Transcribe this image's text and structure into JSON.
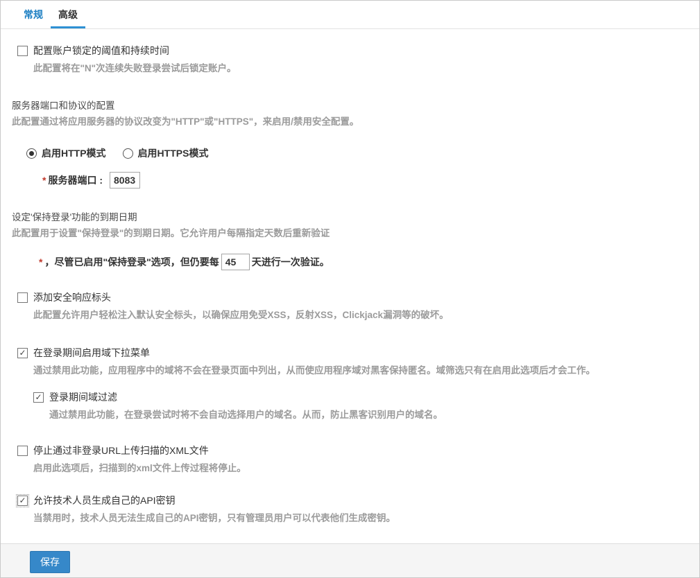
{
  "tabs": [
    {
      "label": "常规",
      "active": false
    },
    {
      "label": "高级",
      "active": true
    }
  ],
  "colors": {
    "accent_blue": "#1b7ec2",
    "tab_underline": "#2e91d4",
    "save_button": "#3688c9",
    "required_red": "#c0392c",
    "description_gray": "#9b9b9b"
  },
  "account_lockout": {
    "label": "配置账户锁定的阈值和持续时间",
    "checked": false,
    "description": "此配置将在\"N\"次连续失败登录尝试后锁定账户。"
  },
  "server": {
    "title": "服务器端口和协议的配置",
    "description": "此配置通过将应用服务器的协议改变为\"HTTP\"或\"HTTPS\"，来启用/禁用安全配置。",
    "http_label": "启用HTTP模式",
    "https_label": "启用HTTPS模式",
    "selected_mode": "HTTP",
    "required_marker": "*",
    "port_label": "服务器端口 :",
    "port_value": "8083"
  },
  "keep_login": {
    "title": "设定'保持登录'功能的到期日期",
    "description": "此配置用于设置\"保持登录\"的到期日期。它允许用户每隔指定天数后重新验证",
    "required_marker": "*",
    "line_prefix": "，尽管已启用\"保持登录\"选项，但仍要每",
    "days_value": "45",
    "line_suffix": "天进行一次验证。"
  },
  "security_headers": {
    "label": "添加安全响应标头",
    "checked": false,
    "description": "此配置允许用户轻松注入默认安全标头，以确保应用免受XSS，反射XSS，Clickjack漏洞等的破坏。"
  },
  "domain_dropdown": {
    "label": "在登录期间启用域下拉菜单",
    "checked": true,
    "description": "通过禁用此功能，应用程序中的域将不会在登录页面中列出，从而使应用程序域对黑客保持匿名。域筛选只有在启用此选项后才会工作。",
    "child": {
      "label": "登录期间域过滤",
      "checked": true,
      "description": "通过禁用此功能，在登录尝试时将不会自动选择用户的域名。从而，防止黑客识别用户的域名。"
    }
  },
  "xml_upload": {
    "label": "停止通过非登录URL上传扫描的XML文件",
    "checked": false,
    "description": "启用此选项后，扫描到的xml文件上传过程将停止。"
  },
  "api_key": {
    "label": "允许技术人员生成自己的API密钥",
    "checked": true,
    "focused": true,
    "description": "当禁用时，技术人员无法生成自己的API密钥，只有管理员用户可以代表他们生成密钥。"
  },
  "footer": {
    "save_label": "保存"
  }
}
